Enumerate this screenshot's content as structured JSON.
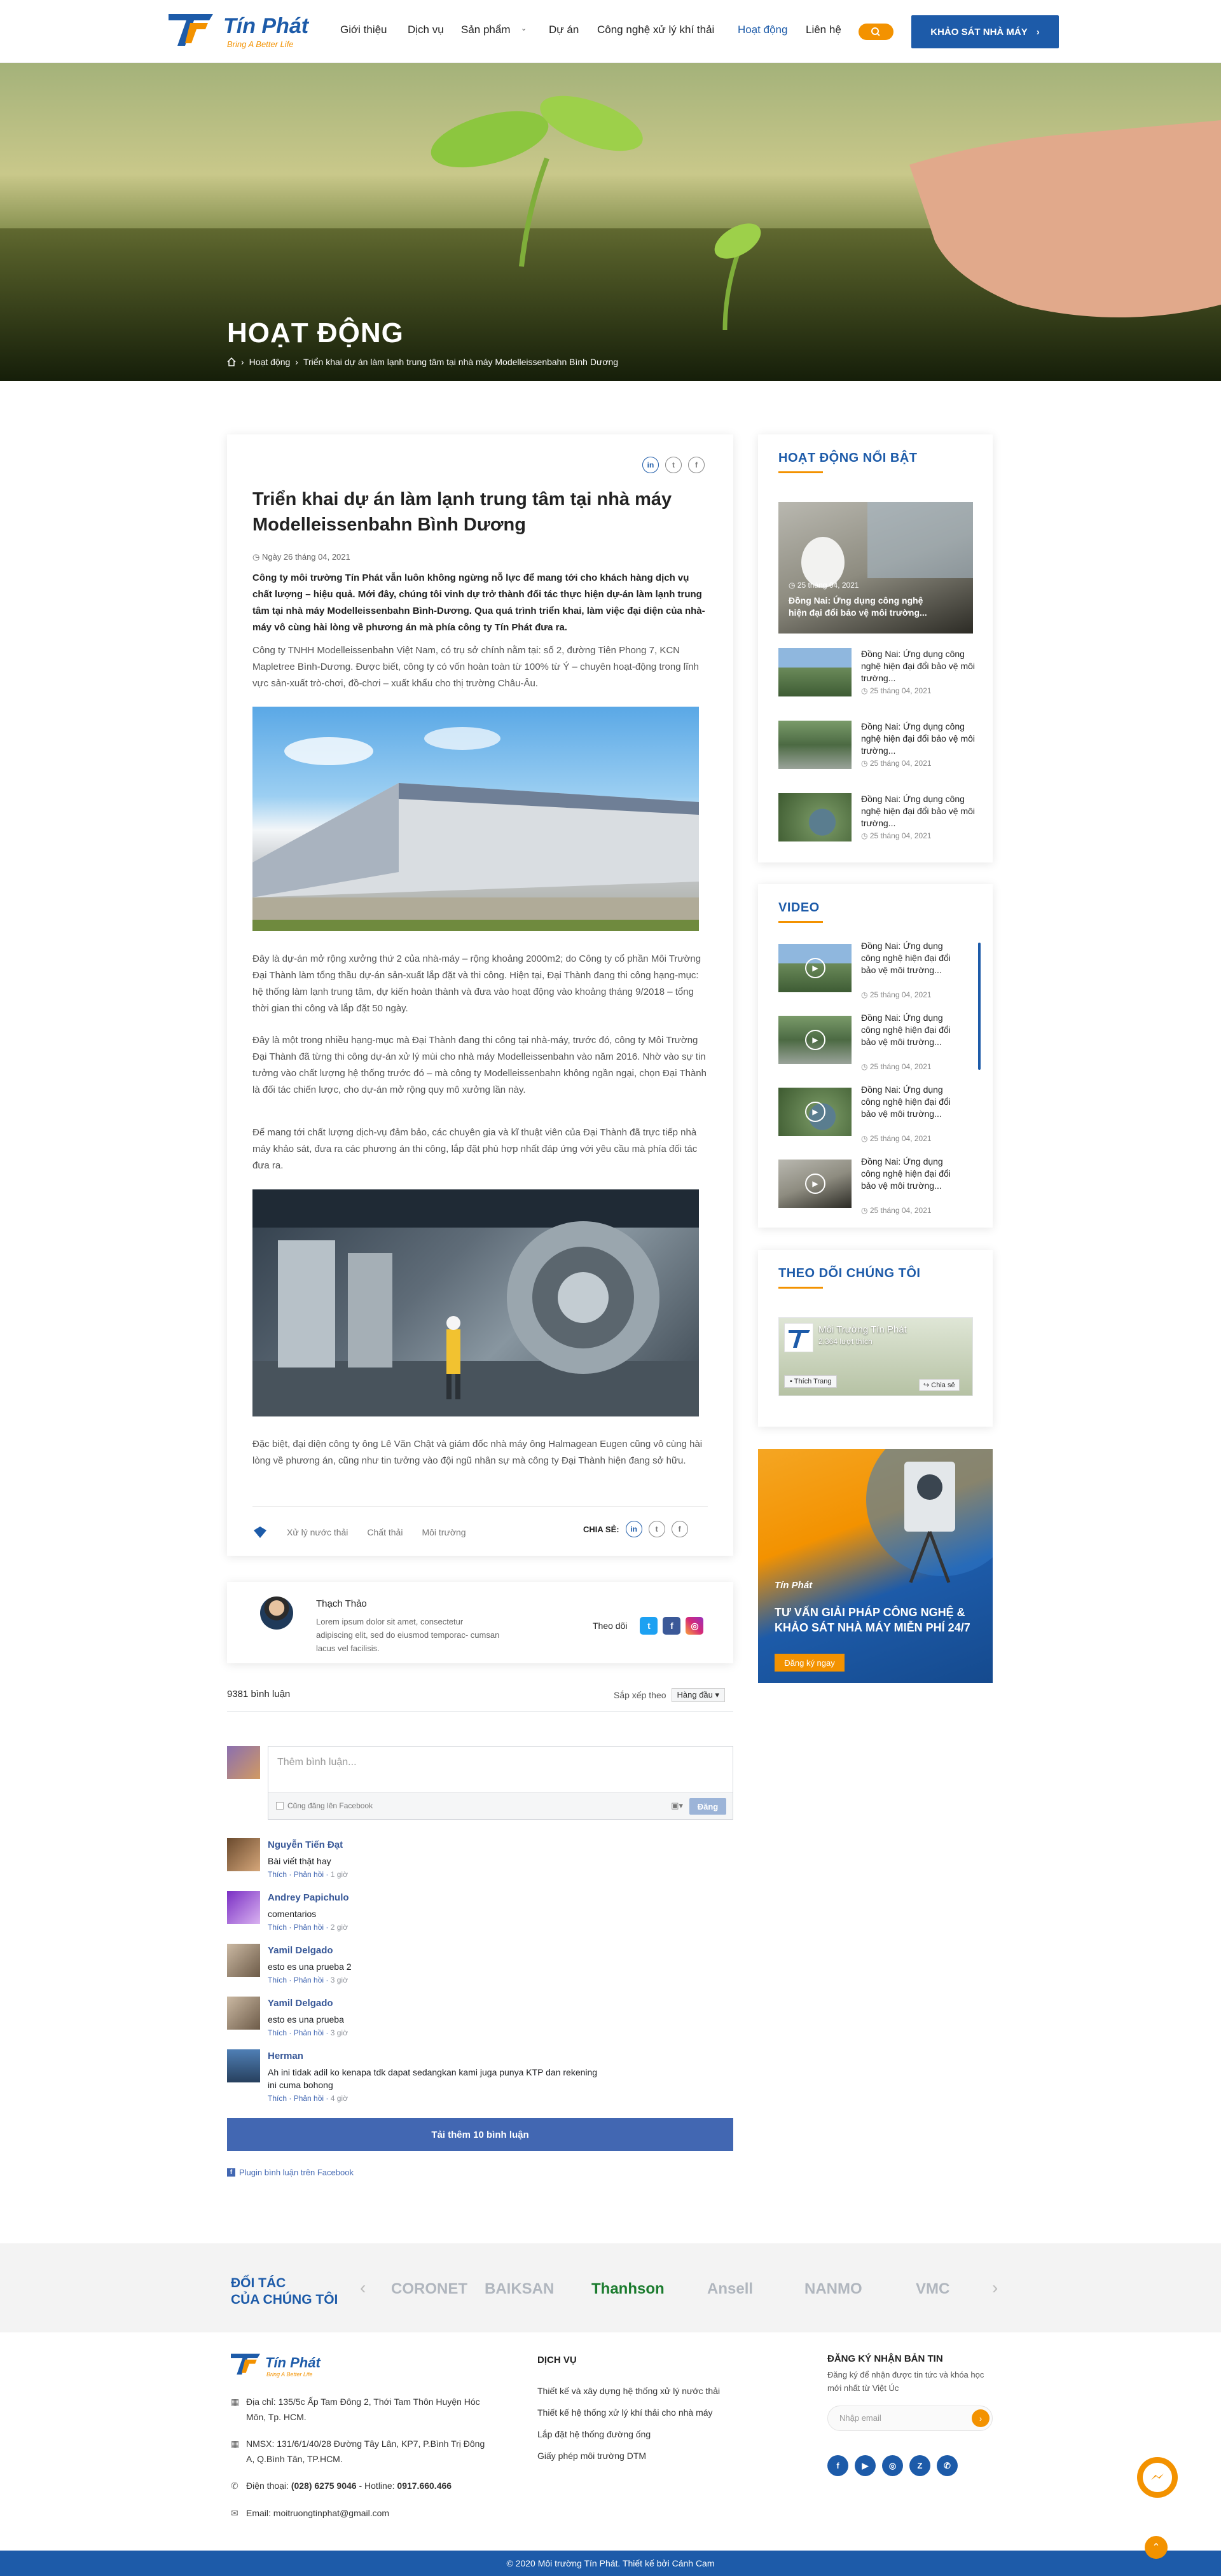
{
  "header": {
    "brand": {
      "name": "Tín Phát",
      "slogan": "Bring A Better Life"
    },
    "nav": [
      {
        "label": "Giới thiệu"
      },
      {
        "label": "Dịch vụ"
      },
      {
        "label": "Sản phẩm"
      },
      {
        "label": "Dự án"
      },
      {
        "label": "Công nghệ xử lý khí thải"
      },
      {
        "label": "Hoạt động",
        "active": true
      },
      {
        "label": "Liên hệ"
      }
    ],
    "cta_label": "KHẢO SÁT NHÀ MÁY",
    "accent": "#f39200",
    "brand_color": "#1d5ba9"
  },
  "banner": {
    "title": "HOẠT ĐỘNG",
    "breadcrumb": [
      "Hoạt động",
      "Triển khai dự án làm lạnh trung tâm tại nhà máy Modelleissenbahn Bình Dương"
    ]
  },
  "article": {
    "title": "Triển khai dự án làm lạnh trung tâm tại nhà máy Modelleissenbahn Bình Dương",
    "date": "Ngày 26 tháng 04, 2021",
    "lead": "Công ty môi trường Tín Phát vẫn luôn không ngừng nỗ lực để mang tới cho khách hàng dịch vụ chất lượng – hiệu quả. Mới đây, chúng tôi vinh dự trở thành đối tác thực hiện dự-án làm lạnh trung tâm tại nhà máy Modelleissenbahn Bình-Dương. Qua quá trình triển khai, làm việc đại diện của nhà-máy vô cùng hài lòng về phương án mà phía công ty Tín Phát đưa ra.",
    "p1": "Công ty TNHH Modelleissenbahn Việt Nam, có trụ sở chính nằm tại: số 2, đường Tiên Phong 7, KCN Mapletree Bình-Dương. Được biết, công ty có vốn hoàn toàn từ 100% từ Ý – chuyên hoạt-động trong lĩnh vực sản-xuất trò-chơi, đồ-chơi – xuất khẩu cho thị trường Châu-Âu.",
    "p2": "Đây là dự-án mở rộng xưởng thứ 2 của nhà-máy – rộng khoảng 2000m2; do Công ty cổ phần Môi Trường Đại Thành làm tổng thầu dự-án sản-xuất lắp đặt và thi công. Hiện tại, Đại Thành đang thi công hạng-mục: hệ thống làm lạnh trung tâm, dự kiến hoàn thành và đưa vào hoạt động vào khoảng tháng 9/2018 – tổng thời gian thi công và lắp đặt 50 ngày.",
    "p3": "Đây là một trong nhiều hạng-mục mà Đại Thành đang thi công tại nhà-máy, trước đó, công ty Môi Trường Đại Thành đã từng thi công dự-án xử lý mùi cho nhà máy Modelleissenbahn vào năm 2016. Nhờ vào sự tin tưởng vào chất lượng hệ thống trước đó – mà công ty Modelleissenbahn không ngần ngại, chọn Đại Thành là đối tác chiến lược, cho dự-án mở rộng quy mô xưởng lần này.",
    "p4": "Để mang tới chất lượng dịch-vụ đảm bảo, các chuyên gia và kĩ thuật viên của Đại Thành đã trực tiếp nhà máy khảo sát, đưa ra các phương án thi công, lắp đặt phù hợp nhất đáp ứng với yêu cầu mà phía đối tác đưa ra.",
    "p5": "Đặc biệt, đại diện công ty ông Lê Văn Chật và giám đốc nhà máy ông Halmagean Eugen cũng vô cùng hài lòng về phương án, cũng như tin tưởng vào đội ngũ nhân sự mà công ty Đại Thành hiện đang sở hữu.",
    "tags": [
      "Xử lý nước thải",
      "Chất thải",
      "Môi trường"
    ],
    "share_label": "CHIA SẺ:"
  },
  "author": {
    "name": "Thạch Thảo",
    "bio": "Lorem ipsum dolor sit amet, consectetur adipiscing elit, sed do eiusmod temporac- cumsan lacus vel facilisis.",
    "follow_label": "Theo dõi"
  },
  "comments": {
    "count_label": "9381 bình luận",
    "sort_label": "Sắp xếp theo",
    "sort_value": "Hàng đầu",
    "placeholder": "Thêm bình luận...",
    "also_post": "Cũng đăng lên Facebook",
    "post_label": "Đăng",
    "reply_label": "Phản hồi",
    "like_label": "Thích",
    "items": [
      {
        "name": "Nguyễn Tiến Đạt",
        "text": "Bài viết thật hay",
        "time": "1 giờ"
      },
      {
        "name": "Andrey Papichulo",
        "text": "comentarios",
        "time": "2 giờ"
      },
      {
        "name": "Yamil Delgado",
        "text": "esto es una prueba 2",
        "time": "3 giờ"
      },
      {
        "name": "Yamil Delgado",
        "text": "esto es una prueba",
        "time": "3 giờ"
      },
      {
        "name": "Herman",
        "text": "Ah ini tidak adil ko kenapa tdk dapat sedangkan kami juga punya KTP dan rekening ini cuma bohong",
        "time": "4 giờ"
      }
    ],
    "load_more": "Tải thêm 10 bình luận",
    "plugin_label": "Plugin bình luận trên Facebook"
  },
  "sidebar": {
    "featured_title": "HOẠT ĐỘNG NỔI BẬT",
    "featured": {
      "title": "Đồng Nai: Ứng dụng công nghệ hiện đại đổi bảo vệ môi trường...",
      "date": "25 tháng 04, 2021"
    },
    "items": [
      {
        "title": "Đồng Nai: Ứng dụng công nghệ hiện đại đổi bảo vệ môi trường...",
        "date": "25 tháng 04, 2021"
      },
      {
        "title": "Đồng Nai: Ứng dụng công nghệ hiện đại đổi bảo vệ môi trường...",
        "date": "25 tháng 04, 2021"
      },
      {
        "title": "Đồng Nai: Ứng dụng công nghệ hiện đại đổi bảo vệ môi trường...",
        "date": "25 tháng 04, 2021"
      }
    ],
    "video_title": "VIDEO",
    "videos": [
      {
        "title": "Đồng Nai: Ứng dụng công nghệ hiện đại đổi bảo vệ môi trường...",
        "date": "25 tháng 04, 2021"
      },
      {
        "title": "Đồng Nai: Ứng dụng công nghệ hiện đại đổi bảo vệ môi trường...",
        "date": "25 tháng 04, 2021"
      },
      {
        "title": "Đồng Nai: Ứng dụng công nghệ hiện đại đổi bảo vệ môi trường...",
        "date": "25 tháng 04, 2021"
      },
      {
        "title": "Đồng Nai: Ứng dụng công nghệ hiện đại đổi bảo vệ môi trường...",
        "date": "25 tháng 04, 2021"
      }
    ],
    "follow_title": "THEO DÕI CHÚNG TÔI",
    "fb_page": {
      "name": "Môi Trường Tín Phát",
      "likes": "2.364 lượt thích",
      "like_btn": "Thích Trang",
      "share_btn": "Chia sẻ"
    },
    "ad": {
      "brand": "Tín Phát",
      "text": "TƯ VẤN GIẢI PHÁP CÔNG NGHỆ & KHẢO SÁT NHÀ MÁY MIỄN PHÍ 24/7",
      "button": "Đăng ký ngay"
    }
  },
  "partners": {
    "title_line1": "ĐỐI TÁC",
    "title_line2": "CỦA CHÚNG TÔI",
    "logos": [
      "CORONET",
      "BAIKSAN",
      "Thanhson",
      "Ansell",
      "NANMO",
      "VMC"
    ]
  },
  "footer": {
    "address": "Địa chỉ: 135/5c Ấp Tam Đông 2, Thới Tam Thôn Huyện Hóc Môn, Tp. HCM.",
    "factory": "NMSX: 131/6/1/40/28 Đường Tây Lân, KP7, P.Bình Trị Đông A, Q.Bình Tân, TP.HCM.",
    "phone_label": "Điện thoại:",
    "phone": "(028) 6275 9046",
    "hotline_label": "- Hotline:",
    "hotline": "0917.660.466",
    "email": "Email: moitruongtinphat@gmail.com",
    "services_title": "DỊCH VỤ",
    "services": [
      "Thiết kế và xây dựng hệ thống xử lý nước thải",
      "Thiết kế hệ thống xử lý khí thải cho nhà máy",
      "Lắp đặt hệ thống đường ống",
      "Giấy phép môi trường DTM"
    ],
    "newsletter_title": "ĐĂNG KÝ NHẬN BẢN TIN",
    "newsletter_desc": "Đăng ký để nhận được tin tức và khóa học mới nhất từ Việt Úc",
    "newsletter_placeholder": "Nhập email",
    "copyright": "© 2020 Môi trường Tín Phát. Thiết kế bởi Cánh Cam"
  }
}
